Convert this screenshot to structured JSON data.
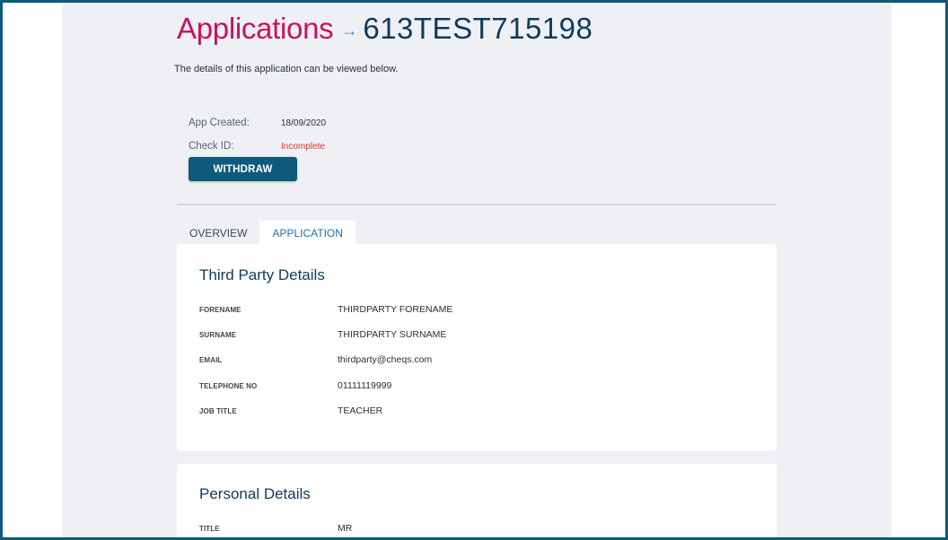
{
  "header": {
    "section": "Applications",
    "arrow": "→",
    "application_id": "613TEST715198",
    "subtitle": "The details of this application can be viewed below."
  },
  "meta": {
    "app_created_label": "App Created:",
    "app_created_value": "18/09/2020",
    "check_id_label": "Check ID:",
    "check_id_value": "Incomplete"
  },
  "actions": {
    "withdraw_label": "WITHDRAW"
  },
  "tabs": [
    {
      "label": "OVERVIEW",
      "active": false
    },
    {
      "label": "APPLICATION",
      "active": true
    }
  ],
  "third_party": {
    "title": "Third Party Details",
    "fields": [
      {
        "label": "FORENAME",
        "value": "THIRDPARTY FORENAME"
      },
      {
        "label": "SURNAME",
        "value": "THIRDPARTY SURNAME"
      },
      {
        "label": "EMAIL",
        "value": "thirdparty@cheqs.com"
      },
      {
        "label": "TELEPHONE NO",
        "value": "01111119999"
      },
      {
        "label": "JOB TITLE",
        "value": "TEACHER"
      }
    ]
  },
  "personal": {
    "title": "Personal Details",
    "fields": [
      {
        "label": "TITLE",
        "value": "MR"
      }
    ]
  },
  "colors": {
    "brand_pink": "#c8115f",
    "brand_navy": "#0f3a5c",
    "button_teal": "#0d5a7a",
    "status_red": "#d83a3a",
    "tab_active_blue": "#1d6fb0"
  }
}
